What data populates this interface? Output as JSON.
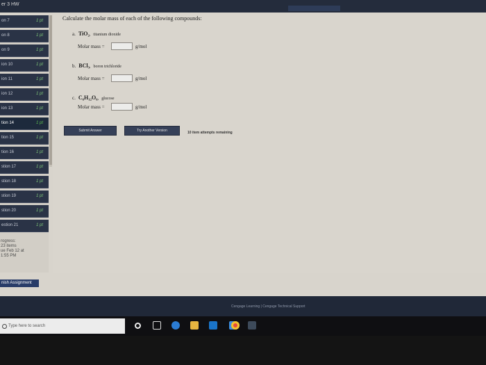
{
  "topbar": {
    "title": "er 3 HW"
  },
  "sidebar": {
    "items": [
      {
        "label": "on 7",
        "points": "1 pt"
      },
      {
        "label": "on 8",
        "points": "1 pt"
      },
      {
        "label": "on 9",
        "points": "1 pt"
      },
      {
        "label": "ion 10",
        "points": "1 pt"
      },
      {
        "label": "ion 11",
        "points": "1 pt"
      },
      {
        "label": "ion 12",
        "points": "1 pt"
      },
      {
        "label": "ion 13",
        "points": "1 pt"
      },
      {
        "label": "tion 14",
        "points": "1 pt"
      },
      {
        "label": "tion 15",
        "points": "1 pt"
      },
      {
        "label": "tion 16",
        "points": "1 pt"
      },
      {
        "label": "stion 17",
        "points": "1 pt"
      },
      {
        "label": "stion 18",
        "points": "1 pt"
      },
      {
        "label": "stion 19",
        "points": "1 pt"
      },
      {
        "label": "stion 20",
        "points": "1 pt"
      },
      {
        "label": "estion 21",
        "points": "1 pt"
      },
      {
        "label": "estion 22",
        "points": "1 pt"
      }
    ],
    "progress": [
      "rogress:",
      "23 items",
      "ue Feb 12 at",
      "1:55 PM"
    ]
  },
  "question": {
    "prompt": "Calculate the molar mass of each of the following compounds:",
    "parts": [
      {
        "letter": "a.",
        "formula": "TiO₂",
        "name": "titanium dioxide",
        "label": "Molar mass =",
        "value": "",
        "unit": "g/mol"
      },
      {
        "letter": "b.",
        "formula": "BCl₃",
        "name": "boron trichloride",
        "label": "Molar mass =",
        "value": "",
        "unit": "g/mol"
      },
      {
        "letter": "c.",
        "formula": "C₆H₁₂O₆",
        "name": "glucose",
        "label": "Molar mass =",
        "value": "",
        "unit": "g/mol"
      }
    ]
  },
  "actions": {
    "submit": "Submit Answer",
    "try_another": "Try Another Version",
    "remaining": "10 item attempts remaining"
  },
  "finish": "nish Assignment",
  "footer": {
    "links": "Cengage Learning  |  Cengage Technical Support"
  },
  "taskbar": {
    "search_placeholder": "Type here to search",
    "icons": [
      "task-view-icon",
      "edge-icon",
      "file-explorer-icon",
      "store-icon",
      "mail-icon",
      "chrome-icon",
      "app-icon"
    ]
  }
}
